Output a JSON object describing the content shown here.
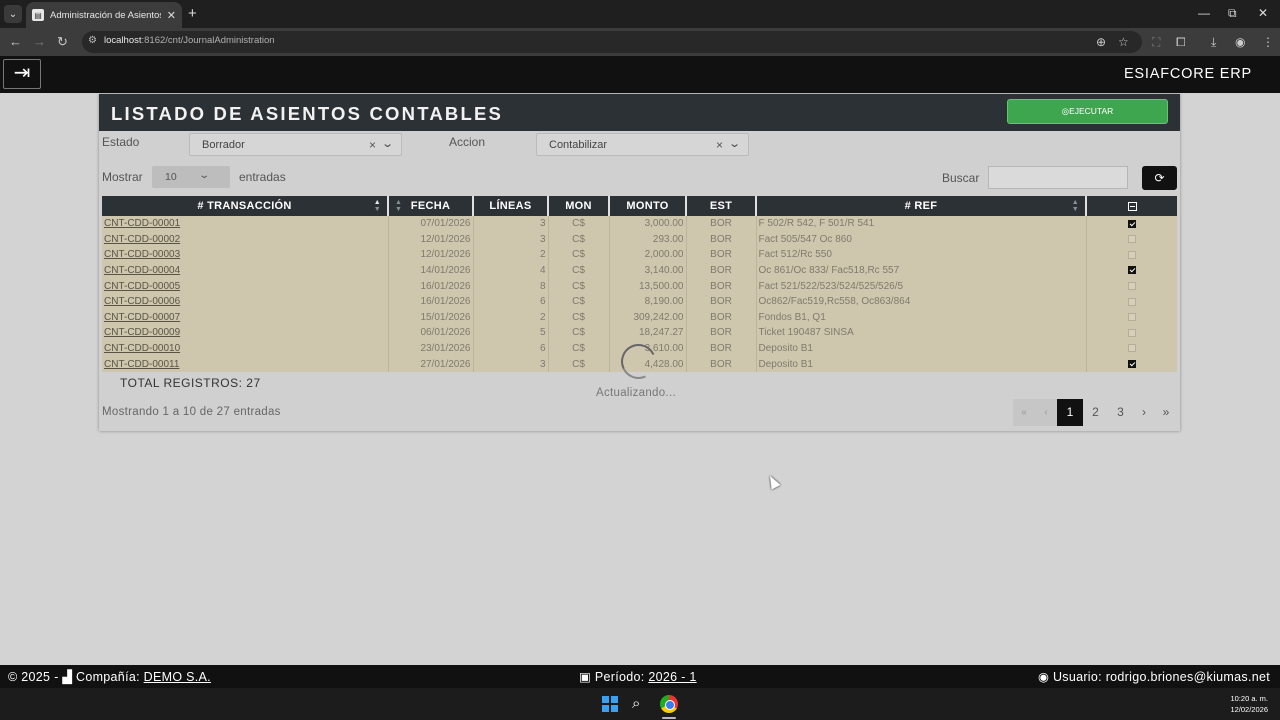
{
  "browser": {
    "tab_title": "Administración de Asientos Co",
    "url_host": "localhost",
    "url_rest": ":8162/cnt/JournalAdministration"
  },
  "app": {
    "brand": "ESIAFCORE ERP"
  },
  "panel": {
    "title": "LISTADO DE ASIENTOS CONTABLES",
    "execute_label": "EJECUTAR",
    "estado_label": "Estado",
    "estado_value": "Borrador",
    "accion_label": "Accion",
    "accion_value": "Contabilizar",
    "mostrar_label": "Mostrar",
    "page_size": "10",
    "entradas_label": "entradas",
    "buscar_label": "Buscar",
    "search_value": ""
  },
  "table": {
    "headers": [
      "# TRANSACCIÓN",
      "FECHA",
      "LÍNEAS",
      "MON",
      "MONTO",
      "EST",
      "# REF"
    ],
    "rows": [
      {
        "id": "CNT-CDD-00001",
        "fecha": "07/01/2026",
        "lineas": "3",
        "mon": "C$",
        "monto": "3,000.00",
        "est": "BOR",
        "ref": "F 502/R 542, F 501/R 541",
        "checked": true
      },
      {
        "id": "CNT-CDD-00002",
        "fecha": "12/01/2026",
        "lineas": "3",
        "mon": "C$",
        "monto": "293.00",
        "est": "BOR",
        "ref": "Fact 505/547 Oc 860",
        "checked": false
      },
      {
        "id": "CNT-CDD-00003",
        "fecha": "12/01/2026",
        "lineas": "2",
        "mon": "C$",
        "monto": "2,000.00",
        "est": "BOR",
        "ref": "Fact 512/Rc 550",
        "checked": false
      },
      {
        "id": "CNT-CDD-00004",
        "fecha": "14/01/2026",
        "lineas": "4",
        "mon": "C$",
        "monto": "3,140.00",
        "est": "BOR",
        "ref": "Oc 861/Oc 833/ Fac518,Rc 557",
        "checked": true
      },
      {
        "id": "CNT-CDD-00005",
        "fecha": "16/01/2026",
        "lineas": "8",
        "mon": "C$",
        "monto": "13,500.00",
        "est": "BOR",
        "ref": "Fact 521/522/523/524/525/526/5",
        "checked": false
      },
      {
        "id": "CNT-CDD-00006",
        "fecha": "16/01/2026",
        "lineas": "6",
        "mon": "C$",
        "monto": "8,190.00",
        "est": "BOR",
        "ref": "Oc862/Fac519,Rc558, Oc863/864",
        "checked": false
      },
      {
        "id": "CNT-CDD-00007",
        "fecha": "15/01/2026",
        "lineas": "2",
        "mon": "C$",
        "monto": "309,242.00",
        "est": "BOR",
        "ref": "Fondos B1, Q1",
        "checked": false
      },
      {
        "id": "CNT-CDD-00009",
        "fecha": "06/01/2026",
        "lineas": "5",
        "mon": "C$",
        "monto": "18,247.27",
        "est": "BOR",
        "ref": "Ticket 190487 SINSA",
        "checked": false
      },
      {
        "id": "CNT-CDD-00010",
        "fecha": "23/01/2026",
        "lineas": "6",
        "mon": "C$",
        "monto": "3,610.00",
        "est": "BOR",
        "ref": "Deposito B1",
        "checked": false
      },
      {
        "id": "CNT-CDD-00011",
        "fecha": "27/01/2026",
        "lineas": "3",
        "mon": "C$",
        "monto": "4,428.00",
        "est": "BOR",
        "ref": "Deposito B1",
        "checked": true
      }
    ]
  },
  "summary": {
    "total": "TOTAL REGISTROS: 27",
    "info": "Mostrando 1 a 10 de 27 entradas",
    "loading": "Actualizando..."
  },
  "pagination": {
    "first": "«",
    "prev": "‹",
    "pages": [
      "1",
      "2",
      "3"
    ],
    "current": "1",
    "next": "›",
    "last": "»"
  },
  "footer": {
    "copyright": "© 2025 -",
    "company_label": "Compañía:",
    "company": "DEMO S.A.",
    "period_label": "Período:",
    "period": "2026 - 1",
    "user_label": "Usuario:",
    "user": "rodrigo.briones@kiumas.net"
  },
  "taskbar": {
    "time": "10:20 a. m.",
    "date": "12/02/2026"
  },
  "colors": {
    "accent_green": "#3fa650",
    "header_dark": "#2c3136",
    "row_bg": "#cfc6ae"
  },
  "icons": [
    "tab-search-icon",
    "page-icon",
    "close-icon",
    "plus-icon",
    "minimize-icon",
    "restore-icon",
    "back-icon",
    "forward-icon",
    "reload-icon",
    "site-info-icon",
    "zoom-icon",
    "star-icon",
    "extensions-icon",
    "download-icon",
    "profile-icon",
    "kebab-icon",
    "sidebar-toggle-icon",
    "whatsapp-icon",
    "refresh-icon",
    "sort-icon",
    "building-icon",
    "calendar-icon",
    "user-icon",
    "windows-icon",
    "search-icon",
    "chrome-icon"
  ]
}
